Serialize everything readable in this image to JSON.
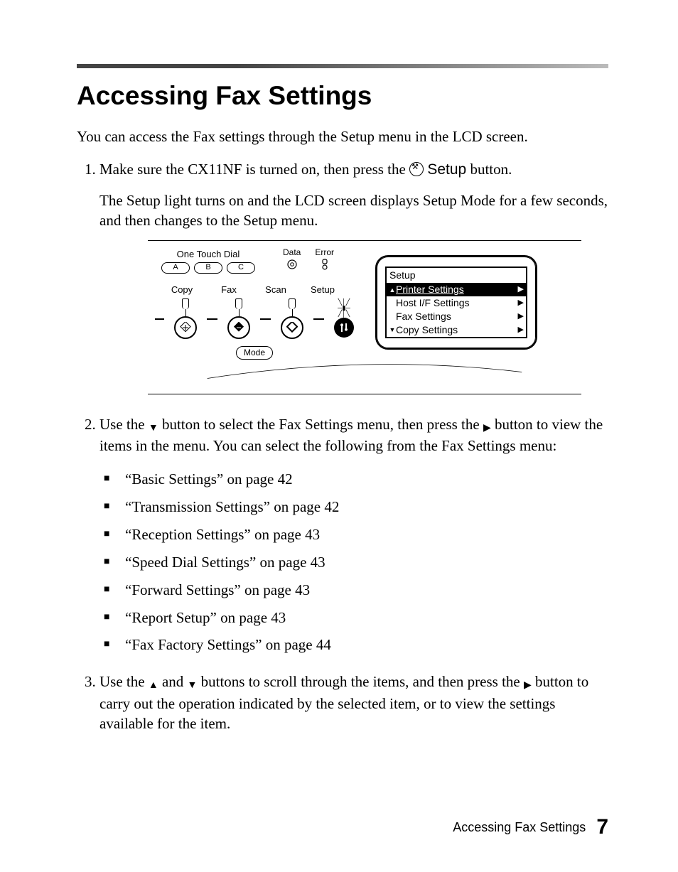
{
  "heading": "Accessing Fax Settings",
  "intro": "You can access the Fax settings through the Setup menu in the LCD screen.",
  "step1": {
    "pre": "Make sure the CX11NF is turned on, then press the ",
    "setup_word": "Setup",
    "post": " button.",
    "para2": "The Setup light turns on and the LCD screen displays Setup Mode for a few seconds, and then changes to the Setup menu."
  },
  "figure": {
    "one_touch_dial": "One Touch Dial",
    "otd_buttons": [
      "A",
      "B",
      "C"
    ],
    "data_label": "Data",
    "error_label": "Error",
    "modes": [
      "Copy",
      "Fax",
      "Scan",
      "Setup"
    ],
    "mode_label": "Mode",
    "lcd": {
      "title": "Setup",
      "items": [
        {
          "label": "Printer Settings",
          "selected": true
        },
        {
          "label": "Host I/F Settings",
          "selected": false
        },
        {
          "label": "Fax Settings",
          "selected": false
        },
        {
          "label": "Copy Settings",
          "selected": false
        }
      ]
    }
  },
  "step2": {
    "pre": "Use the ",
    "mid": " button to select the Fax Settings menu, then press the ",
    "post": " button to view the items in the menu. You can select the following from the Fax Settings menu:"
  },
  "bullets": [
    "“Basic Settings” on page 42",
    "“Transmission Settings” on page 42",
    "“Reception Settings” on page 43",
    "“Speed Dial Settings” on page 43",
    "“Forward Settings” on page 43",
    "“Report Setup” on page 43",
    "“Fax Factory Settings” on page 44"
  ],
  "step3": {
    "pre": "Use the ",
    "mid1": " and ",
    "mid2": " buttons to scroll through the items, and then press the ",
    "post": " button to carry out the operation indicated by the selected item, or to view the settings available for the item."
  },
  "footer_text": "Accessing Fax Settings",
  "page_number": "7"
}
